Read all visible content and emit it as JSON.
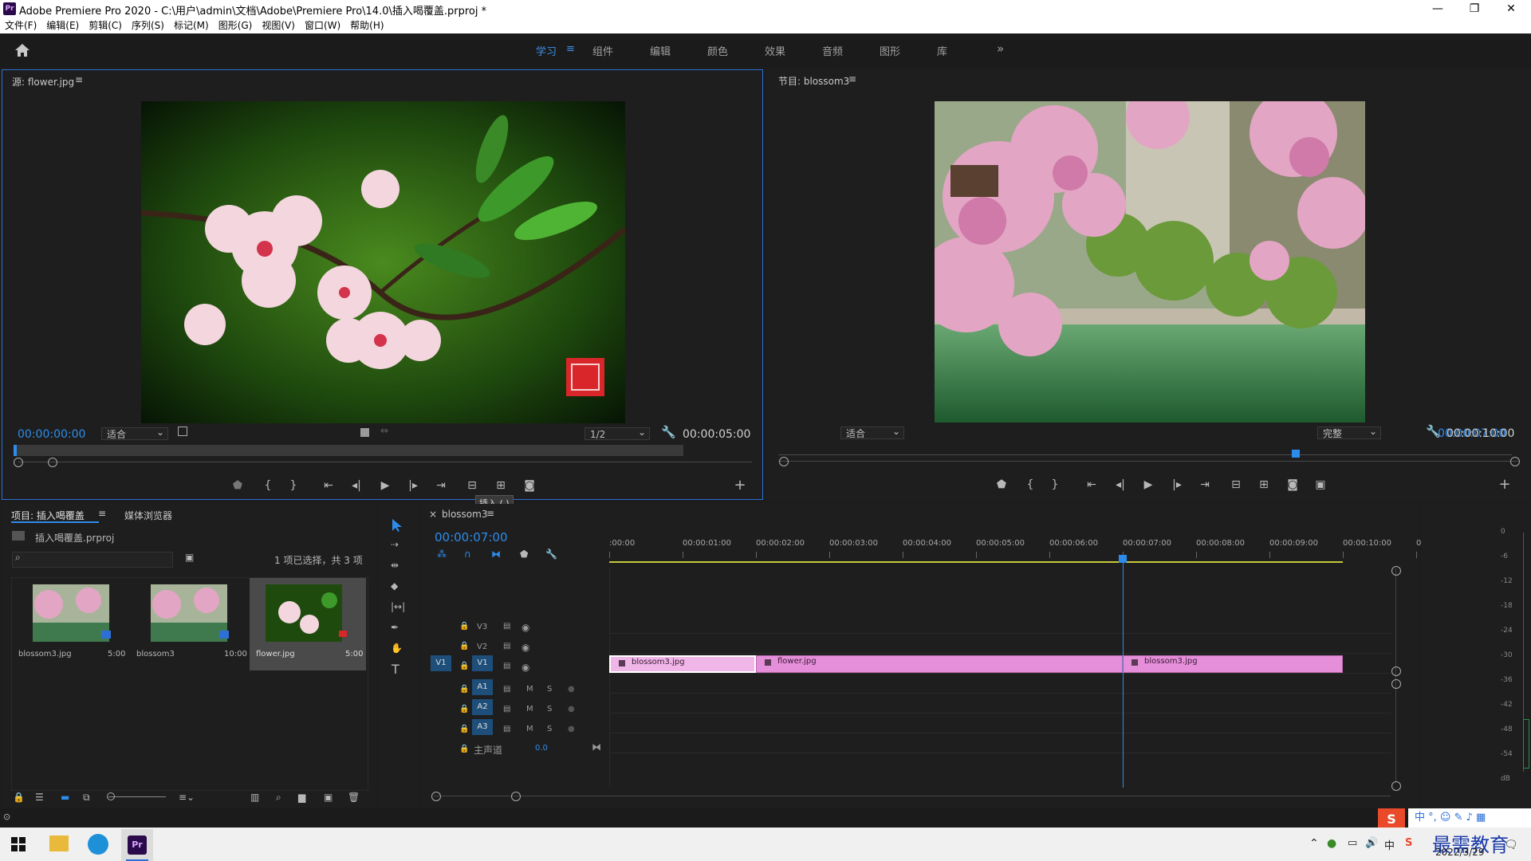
{
  "window": {
    "title": "Adobe Premiere Pro 2020 - C:\\用户\\admin\\文档\\Adobe\\Premiere Pro\\14.0\\插入喝覆盖.prproj *",
    "app_badge": "Pr",
    "minimize": "—",
    "restore": "❐",
    "close": "✕"
  },
  "menu": [
    "文件(F)",
    "编辑(E)",
    "剪辑(C)",
    "序列(S)",
    "标记(M)",
    "图形(G)",
    "视图(V)",
    "窗口(W)",
    "帮助(H)"
  ],
  "workspaces": {
    "items": [
      "学习",
      "组件",
      "编辑",
      "颜色",
      "效果",
      "音频",
      "图形",
      "库"
    ],
    "active": "学习",
    "more": "»"
  },
  "source_monitor": {
    "title": "源: flower.jpg",
    "timecode": "00:00:00:00",
    "fit": "适合",
    "resolution": "1/2",
    "duration": "00:00:05:00",
    "tooltip": "插入 (,)"
  },
  "program_monitor": {
    "title": "节目: blossom3",
    "timecode": "00:00:07:00",
    "fit": "适合",
    "quality": "完整",
    "duration": "00:00:10:00"
  },
  "project_panel": {
    "tab_project": "项目: 插入喝覆盖",
    "tab_media": "媒体浏览器",
    "file": "插入喝覆盖.prproj",
    "selection_info": "1 项已选择，共 3 项",
    "items": [
      {
        "name": "blossom3.jpg",
        "duration": "5:00"
      },
      {
        "name": "blossom3",
        "duration": "10:00"
      },
      {
        "name": "flower.jpg",
        "duration": "5:00"
      }
    ]
  },
  "timeline": {
    "tab": "blossom3",
    "timecode": "00:00:07:00",
    "ruler": [
      ":00:00",
      "00:00:01:00",
      "00:00:02:00",
      "00:00:03:00",
      "00:00:04:00",
      "00:00:05:00",
      "00:00:06:00",
      "00:00:07:00",
      "00:00:08:00",
      "00:00:09:00",
      "00:00:10:00",
      "00"
    ],
    "video_tracks": [
      "V3",
      "V2",
      "V1"
    ],
    "audio_tracks": [
      "A1",
      "A2",
      "A3"
    ],
    "source_patch": "V1",
    "mute": "M",
    "solo": "S",
    "master_label": "主声道",
    "master_value": "0.0",
    "clips": [
      {
        "name": "blossom3.jpg",
        "start": 0,
        "end": 2
      },
      {
        "name": "flower.jpg",
        "start": 2,
        "end": 7
      },
      {
        "name": "blossom3.jpg",
        "start": 7,
        "end": 10
      }
    ],
    "playhead_seconds": 7
  },
  "meter": {
    "labels": [
      "0",
      "-6",
      "-12",
      "-18",
      "-24",
      "-30",
      "-36",
      "-42",
      "-48",
      "-54",
      "dB"
    ]
  },
  "taskbar": {
    "date": "2022/3/29",
    "ime": "中",
    "watermark": "最需教育"
  }
}
